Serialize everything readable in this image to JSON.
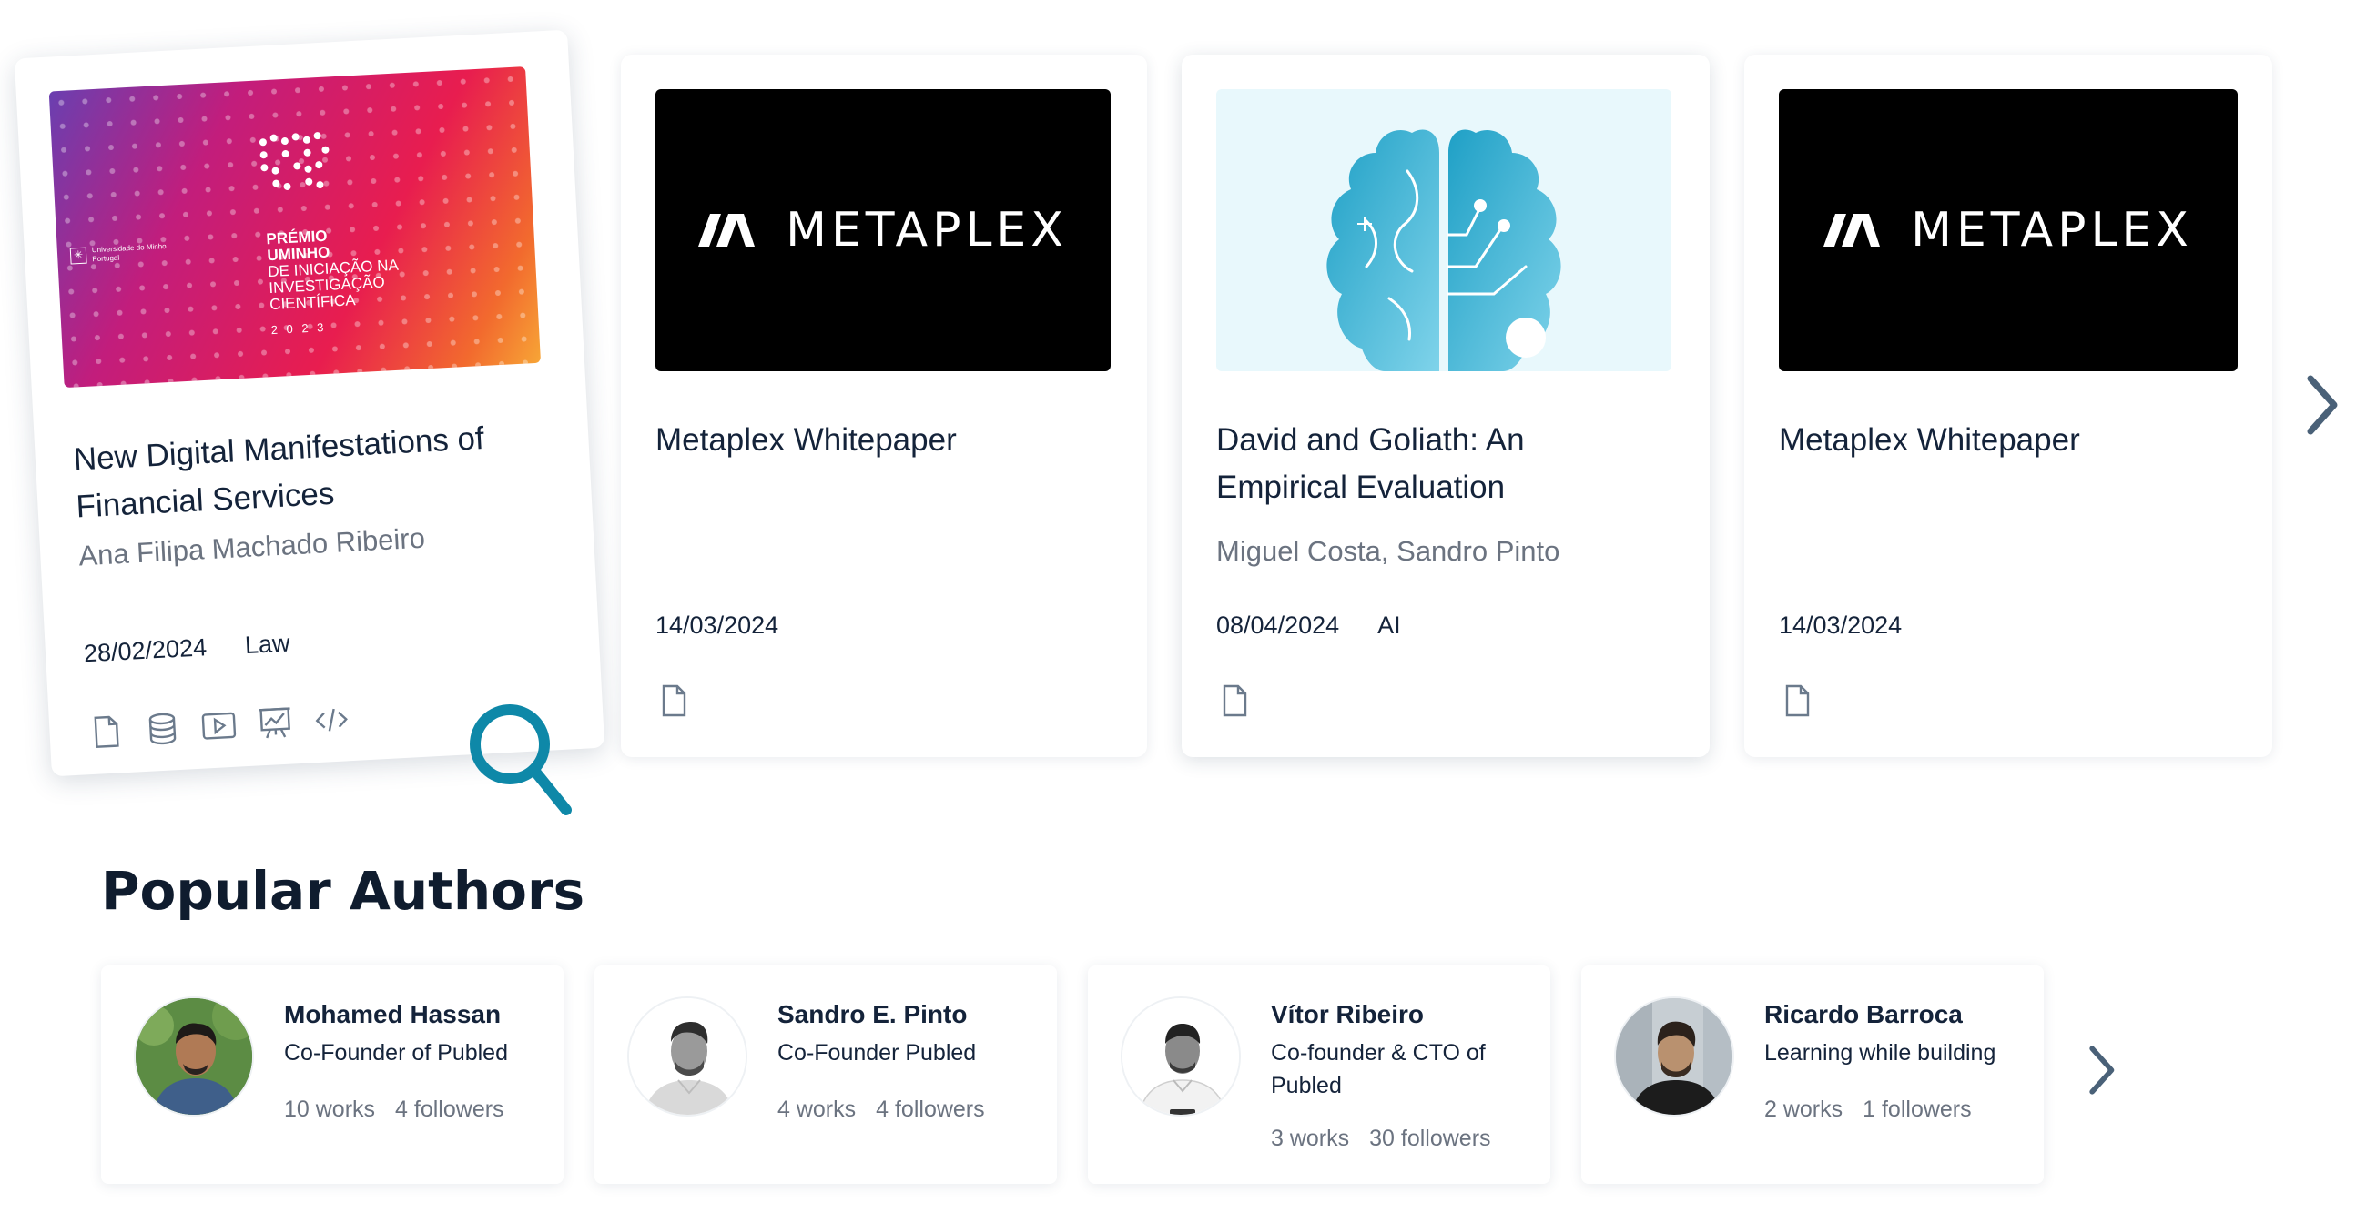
{
  "works": [
    {
      "title": "New Digital Manifestations of Financial Services",
      "authors": "Ana Filipa Machado Ribeiro",
      "date": "28/02/2024",
      "category": "Law",
      "thumb": {
        "university": "Universidade do Minho",
        "university_sub": "Portugal",
        "award_line1": "PRÉMIO",
        "award_line2": "UMINHO",
        "award_line3": "DE INICIAÇÃO NA",
        "award_line4": "INVESTIGAÇÃO",
        "award_line5": "CIENTÍFICA",
        "year": "2 0 2 3"
      },
      "icons": [
        "document-icon",
        "database-icon",
        "video-icon",
        "presentation-icon",
        "code-icon"
      ]
    },
    {
      "title": "Metaplex Whitepaper",
      "authors": "",
      "date": "14/03/2024",
      "category": "",
      "thumb_text": "METAPLEX",
      "icons": [
        "document-icon"
      ]
    },
    {
      "title": "David and Goliath: An Empirical Evaluation",
      "authors": "Miguel Costa, Sandro Pinto",
      "date": "08/04/2024",
      "category": "AI",
      "icons": [
        "document-icon"
      ]
    },
    {
      "title": "Metaplex Whitepaper",
      "authors": "",
      "date": "14/03/2024",
      "category": "",
      "thumb_text": "METAPLEX",
      "icons": [
        "document-icon"
      ]
    }
  ],
  "popular_authors": {
    "heading": "Popular Authors",
    "items": [
      {
        "name": "Mohamed Hassan",
        "role": "Co-Founder of Publed",
        "works": "10 works",
        "followers": "4 followers"
      },
      {
        "name": "Sandro E. Pinto",
        "role": "Co-Founder Publed",
        "works": "4 works",
        "followers": "4 followers"
      },
      {
        "name": "Vítor Ribeiro",
        "role": "Co-founder & CTO of Publed",
        "works": "3 works",
        "followers": "30 followers"
      },
      {
        "name": "Ricardo Barroca",
        "role": "Learning while building",
        "works": "2 works",
        "followers": "1 followers"
      }
    ]
  },
  "colors": {
    "accent": "#0e88a8",
    "arrow": "#4a6178",
    "brain": "#2aa6c9",
    "brain_bg": "#e8f8fc"
  },
  "icons": {
    "next": "chevron-right-icon",
    "zoom": "magnifier-icon"
  }
}
